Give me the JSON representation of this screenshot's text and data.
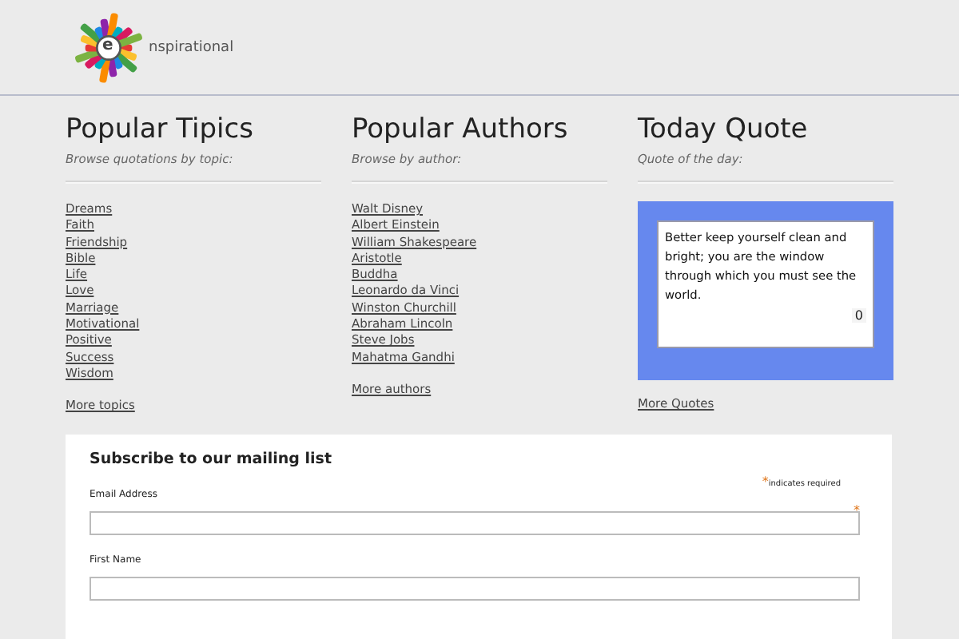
{
  "logo": {
    "mark": "e",
    "text": "nspirational"
  },
  "columns": [
    {
      "title": "Popular Tipics",
      "subtitle": "Browse quotations by topic:",
      "links": [
        "Dreams",
        "Faith",
        "Friendship",
        "Bible",
        "Life",
        "Love",
        "Marriage",
        "Motivational",
        "Positive",
        "Success",
        "Wisdom"
      ],
      "more": "More topics"
    },
    {
      "title": "Popular Authors",
      "subtitle": "Browse by author:",
      "links": [
        "Walt Disney",
        "Albert Einstein",
        "William Shakespeare",
        "Aristotle",
        "Buddha",
        "Leonardo da Vinci",
        "Winston Churchill",
        "Abraham Lincoln",
        "Steve Jobs",
        "Mahatma Gandhi"
      ],
      "more": "More authors"
    }
  ],
  "quote_column": {
    "title": "Today Quote",
    "subtitle": "Quote of the day:",
    "quote": "Better keep yourself clean and bright; you are the window through which you must see the world.",
    "count": "0",
    "more": "More Quotes"
  },
  "form": {
    "title": "Subscribe to our mailing list",
    "required_mark": "*",
    "required_note": "indicates required",
    "fields": [
      {
        "label": "Email Address",
        "required": true
      },
      {
        "label": "First Name",
        "required": false
      }
    ]
  }
}
